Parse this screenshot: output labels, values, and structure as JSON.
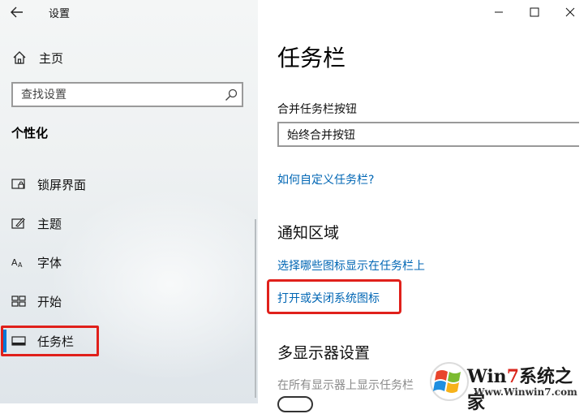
{
  "window": {
    "title": "设置",
    "controls": [
      "minimize-icon",
      "maximize-icon",
      "close-icon"
    ]
  },
  "sidebar": {
    "home_label": "主页",
    "search_placeholder": "查找设置",
    "section_title": "个性化",
    "items": [
      {
        "label": "锁屏界面",
        "icon": "lock-screen-icon"
      },
      {
        "label": "主题",
        "icon": "theme-icon"
      },
      {
        "label": "字体",
        "icon": "font-icon"
      },
      {
        "label": "开始",
        "icon": "start-icon"
      },
      {
        "label": "任务栏",
        "icon": "taskbar-icon",
        "selected": true
      }
    ]
  },
  "main": {
    "page_title": "任务栏",
    "combine_label": "合并任务栏按钮",
    "combine_value": "始终合并按钮",
    "customize_link": "如何自定义任务栏?",
    "notification": {
      "title": "通知区域",
      "link_select_icons": "选择哪些图标显示在任务栏上",
      "link_system_icons": "打开或关闭系统图标"
    },
    "multi_display": {
      "title": "多显示器设置",
      "show_all_label": "在所有显示器上显示任务栏"
    }
  },
  "watermark": {
    "brand_prefix": "Win",
    "brand_seven": "7",
    "brand_suffix": "系统之家",
    "url": "Www.Winwin7.com"
  },
  "colors": {
    "accent": "#0078d7",
    "link": "#0066b4",
    "highlight_box": "#e0201b"
  }
}
